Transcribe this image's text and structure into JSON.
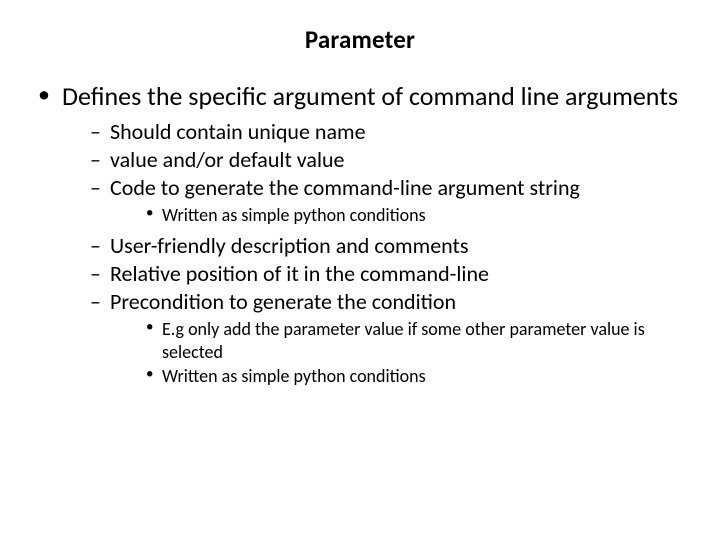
{
  "title": "Parameter",
  "l1": "Defines the specific argument of command line arguments",
  "l2a": "Should contain unique name",
  "l2b": "value and/or default value",
  "l2c": "Code to generate the command-line argument string",
  "l3a": "Written as simple python conditions",
  "l2d": "User-friendly description and comments",
  "l2e": "Relative position of it in the command-line",
  "l2f": "Precondition to generate the condition",
  "l3b": "E.g only add the parameter value if some other parameter value is selected",
  "l3c": "Written as simple python conditions"
}
